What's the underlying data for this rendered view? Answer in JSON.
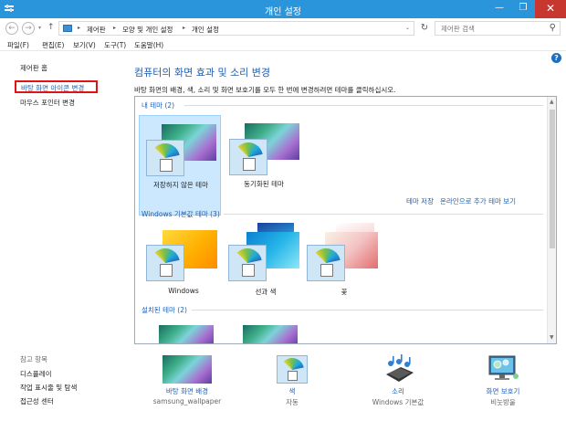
{
  "window": {
    "title": "개인 설정",
    "minimize_glyph": "—",
    "maximize_glyph": "❐",
    "close_glyph": "✕"
  },
  "address": {
    "back_glyph": "←",
    "forward_glyph": "→",
    "recent_glyph": "▾",
    "up_glyph": "↑",
    "crumbs": [
      "제어판",
      "모양 및 개인 설정",
      "개인 설정"
    ],
    "crumb_sep": "▸",
    "dropdown_glyph": "⌄",
    "refresh_glyph": "↻",
    "search_placeholder": "제어판 검색",
    "search_glyph": "⚲"
  },
  "menu": [
    "파일(F)",
    "편집(E)",
    "보기(V)",
    "도구(T)",
    "도움말(H)"
  ],
  "left_pane": {
    "home": "제어판 홈",
    "desktop_icons": "바탕 화면 아이콘 변경",
    "mouse_pointers": "마우스 포인터 변경",
    "see_also": "참고 항목",
    "links": [
      "디스플레이",
      "작업 표시줄 및 탐색",
      "접근성 센터"
    ]
  },
  "help_glyph": "?",
  "main": {
    "heading": "컴퓨터의 화면 효과 및 소리 변경",
    "description": "바탕 화면의 배경, 색, 소리 및 화면 보호기를 모두 한 번에 변경하려면 테마를 클릭하십시오."
  },
  "themes": {
    "my_themes_label": "내 테마 (2)",
    "my_themes": [
      {
        "name": "저장하지 않은 테마",
        "selected": true
      },
      {
        "name": "동기화된 테마",
        "selected": false
      }
    ],
    "save_theme_link": "테마 저장",
    "get_more_link": "온라인으로 추가 테마 보기",
    "windows_default_label": "Windows 기본값 테마 (3)",
    "windows_default": [
      {
        "name": "Windows"
      },
      {
        "name": "선과 색"
      },
      {
        "name": "꽃"
      }
    ],
    "installed_label": "설치된 테마 (2)",
    "scroll_up_glyph": "▲",
    "scroll_down_glyph": "▼"
  },
  "bottom": [
    {
      "label": "바탕 화면 배경",
      "sub": "samsung_wallpaper"
    },
    {
      "label": "색",
      "sub": "자동"
    },
    {
      "label": "소리",
      "sub": "Windows 기본값"
    },
    {
      "label": "화면 보호기",
      "sub": "비눗방울"
    }
  ],
  "colors": {
    "titlebar": "#2b95db",
    "close_button": "#c7372f",
    "link_blue": "#1e5fb4",
    "highlight_border": "#e01414",
    "selection": "#cce8ff"
  }
}
